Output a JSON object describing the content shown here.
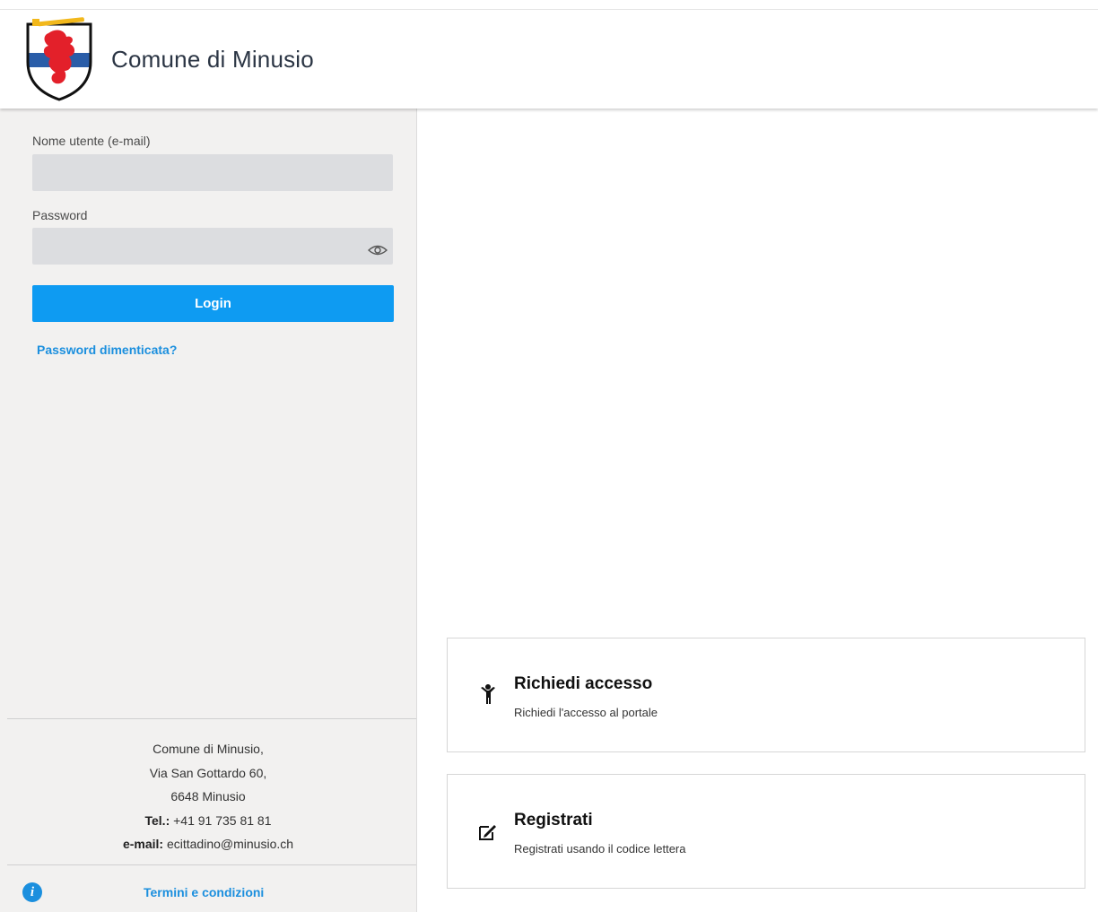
{
  "header": {
    "title": "Comune di Minusio",
    "logo_icon": "coat-of-arms-icon"
  },
  "login": {
    "username_label": "Nome utente (e-mail)",
    "username_value": "",
    "password_label": "Password",
    "password_value": "",
    "show_password_icon": "eye-icon",
    "login_button": "Login",
    "forgot_link": "Password dimenticata?"
  },
  "footer": {
    "name": "Comune di Minusio,",
    "street": "Via San Gottardo 60,",
    "city": "6648 Minusio",
    "tel_label": "Tel.:",
    "tel_value": "+41 91 735 81 81",
    "email_label": "e-mail:",
    "email_value": "ecittadino@minusio.ch",
    "info_icon": "info-icon",
    "terms_link": "Termini e condizioni"
  },
  "cards": [
    {
      "icon": "person-icon",
      "title": "Richiedi accesso",
      "description": "Richiedi l'accesso al portale"
    },
    {
      "icon": "edit-box-icon",
      "title": "Registrati",
      "description": "Registrati usando il codice lettera"
    }
  ],
  "colors": {
    "accent": "#0e9bf2",
    "link": "#1b8fde",
    "sidebar_bg": "#f2f1f0",
    "input_bg": "#dcdde0",
    "emblem_red": "#e3202a",
    "emblem_blue": "#2a5da8",
    "emblem_gold": "#f2b81c"
  }
}
